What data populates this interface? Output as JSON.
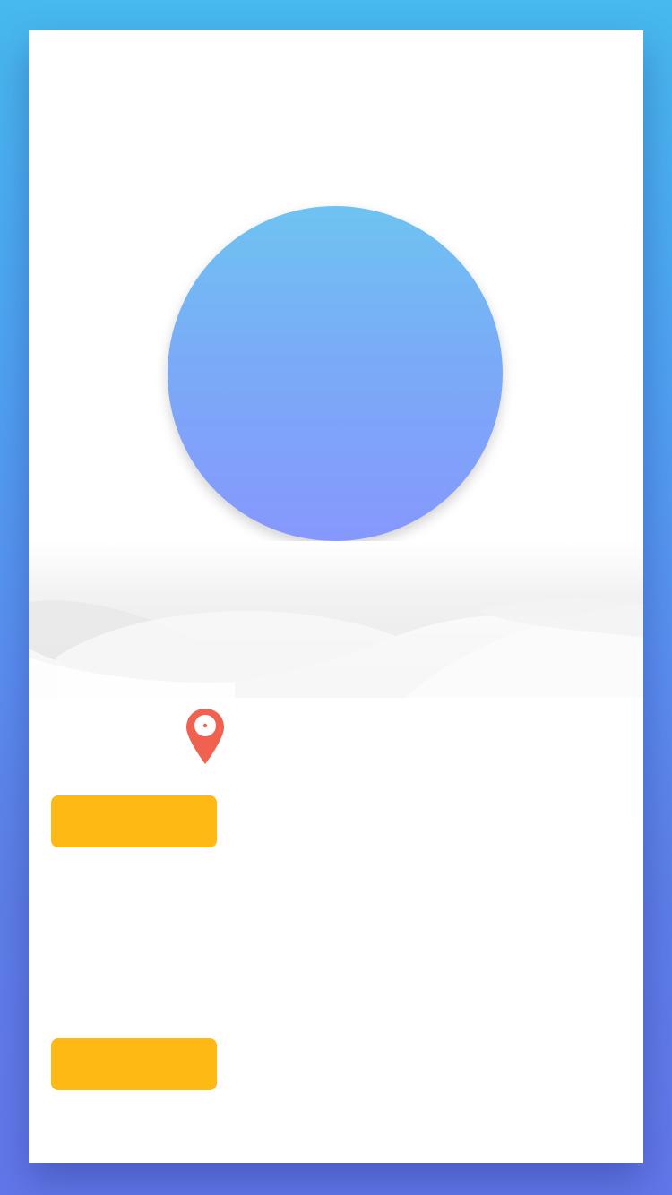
{
  "colors": {
    "background_top": "#47b9ee",
    "background_bottom": "#6277e9",
    "card": "#ffffff",
    "circle_top": "#6ec3f1",
    "circle_bottom": "#8698fd",
    "pin": "#f0614f",
    "button": "#ffb914"
  },
  "icons": {
    "location": "map-pin-icon"
  },
  "buttons": {
    "first_label": "",
    "second_label": ""
  }
}
